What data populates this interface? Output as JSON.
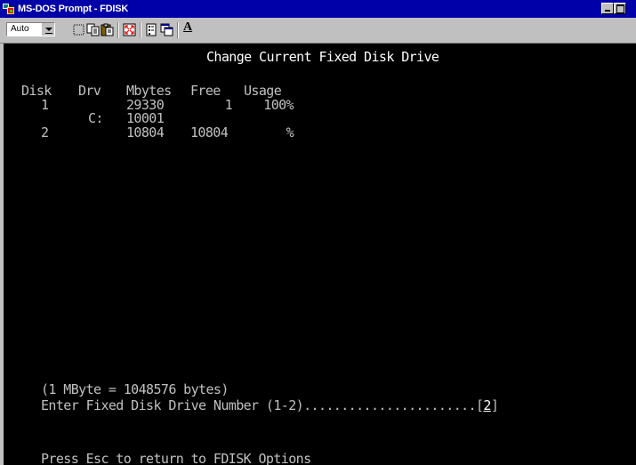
{
  "window": {
    "title": "MS-DOS Prompt - FDISK",
    "icon": "msdos-icon"
  },
  "toolbar": {
    "font_size_value": "Auto",
    "buttons": [
      "mark-icon",
      "copy-icon",
      "paste-icon",
      "fullscreen-icon",
      "properties-icon",
      "background-icon",
      "font-icon"
    ],
    "font_label": "A"
  },
  "screen": {
    "heading": "Change Current Fixed Disk Drive",
    "columns": [
      "Disk",
      "Drv",
      "Mbytes",
      "Free",
      "Usage"
    ],
    "rows": [
      {
        "disk": "1",
        "drv": "",
        "mbytes": "29330",
        "free": "1",
        "usage": "100%"
      },
      {
        "disk": "",
        "drv": "C:",
        "mbytes": "10001",
        "free": "",
        "usage": ""
      },
      {
        "disk": "2",
        "drv": "",
        "mbytes": "10804",
        "free": "10804",
        "usage": "%"
      }
    ],
    "note": "(1 MByte = 1048576 bytes)",
    "prompt_text": "Enter Fixed Disk Drive Number (1-2).......................[",
    "prompt_value": "2",
    "prompt_close": "]",
    "footer": "Press Esc to return to FDISK Options"
  },
  "colors": {
    "titlebar": "#0000a8",
    "screen_bg": "#000000",
    "screen_fg": "#c0c0c0"
  }
}
